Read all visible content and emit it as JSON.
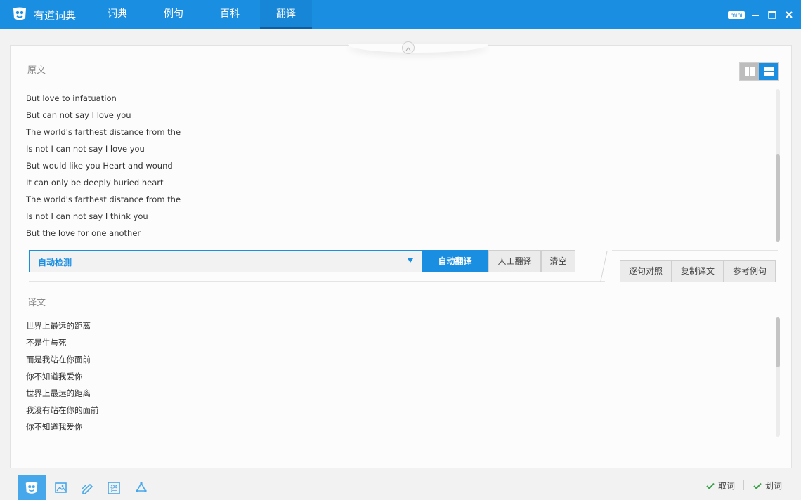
{
  "app": {
    "name": "有道词典",
    "brand_color": "#1a8ee1"
  },
  "nav": {
    "tabs": [
      {
        "label": "词典"
      },
      {
        "label": "例句"
      },
      {
        "label": "百科"
      },
      {
        "label": "翻译"
      }
    ],
    "active_tab": "翻译"
  },
  "window": {
    "mini_label": "mini"
  },
  "source": {
    "title": "原文",
    "lines": [
      "But love to infatuation",
      "But can not say I love you",
      "The world's farthest distance from the",
      "Is not I can not say I love you",
      "But would like you Heart and wound",
      "It can only be deeply buried heart",
      "The world's farthest distance from the",
      "Is not I can not say I think you",
      "But the love for one another"
    ]
  },
  "toolbar": {
    "language_select": "自动检测",
    "auto_translate": "自动翻译",
    "human_translate": "人工翻译",
    "clear": "清空",
    "sentence_compare": "逐句对照",
    "copy_translation": "复制译文",
    "reference_examples": "参考例句"
  },
  "target": {
    "title": "译文",
    "lines": [
      "世界上最远的距离",
      "不是生与死",
      "而是我站在你面前",
      "你不知道我爱你",
      "世界上最远的距离",
      "我没有站在你的面前",
      "你不知道我爱你"
    ]
  },
  "bottom": {
    "icons": [
      "youdao-logo-icon",
      "image-translate-icon",
      "pen-icon",
      "translate-icon",
      "recycle-icon"
    ],
    "options": [
      {
        "label": "取词",
        "checked": true
      },
      {
        "label": "划词",
        "checked": true
      }
    ],
    "check_color": "#3aa34a"
  }
}
